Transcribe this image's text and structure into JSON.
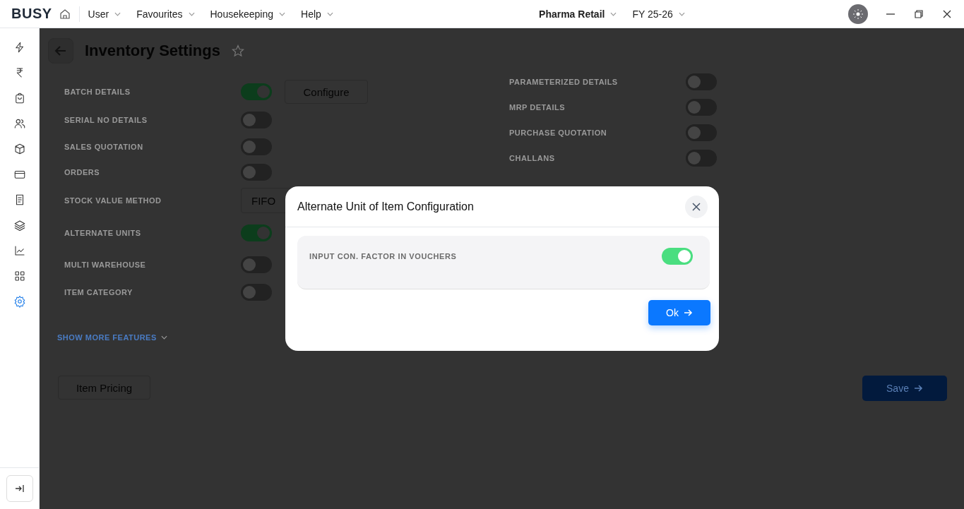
{
  "topbar": {
    "logo": "BUSY",
    "menus": [
      {
        "label": "User"
      },
      {
        "label": "Favourites"
      },
      {
        "label": "Housekeeping"
      },
      {
        "label": "Help"
      }
    ],
    "company": "Pharma Retail",
    "year": "FY 25-26"
  },
  "sidebar": {
    "items": [
      {
        "selected": false
      },
      {
        "selected": false
      },
      {
        "selected": false
      },
      {
        "selected": false
      },
      {
        "selected": false
      },
      {
        "selected": false
      },
      {
        "selected": false
      },
      {
        "selected": false
      },
      {
        "selected": false
      },
      {
        "selected": false
      },
      {
        "selected": true
      }
    ]
  },
  "page": {
    "title": "Inventory Settings",
    "left_settings": [
      {
        "kind": "toggle",
        "label": "BATCH DETAILS",
        "on": true,
        "button": "Configure"
      },
      {
        "kind": "toggle",
        "label": "SERIAL NO DETAILS",
        "on": false
      },
      {
        "kind": "toggle",
        "label": "SALES QUOTATION",
        "on": false
      },
      {
        "kind": "toggle",
        "label": "ORDERS",
        "on": false
      },
      {
        "kind": "select",
        "label": "STOCK VALUE METHOD",
        "value": "FIFO"
      },
      {
        "kind": "toggle",
        "label": "ALTERNATE UNITS",
        "on": true
      },
      {
        "kind": "toggle",
        "label": "MULTI WAREHOUSE",
        "on": false
      },
      {
        "kind": "toggle",
        "label": "ITEM CATEGORY",
        "on": false
      }
    ],
    "right_settings": [
      {
        "kind": "toggle",
        "label": "PARAMETERIZED DETAILS",
        "on": false
      },
      {
        "kind": "toggle",
        "label": "MRP DETAILS",
        "on": false
      },
      {
        "kind": "toggle",
        "label": "PURCHASE QUOTATION",
        "on": false
      },
      {
        "kind": "toggle",
        "label": "CHALLANS",
        "on": false
      }
    ],
    "show_more": "SHOW MORE FEATURES",
    "item_pricing": "Item Pricing",
    "save": "Save"
  },
  "dialog": {
    "title": "Alternate Unit of Item Configuration",
    "settings": [
      {
        "label": "INPUT CON. FACTOR IN VOUCHERS",
        "on": true
      }
    ],
    "ok": "Ok"
  }
}
